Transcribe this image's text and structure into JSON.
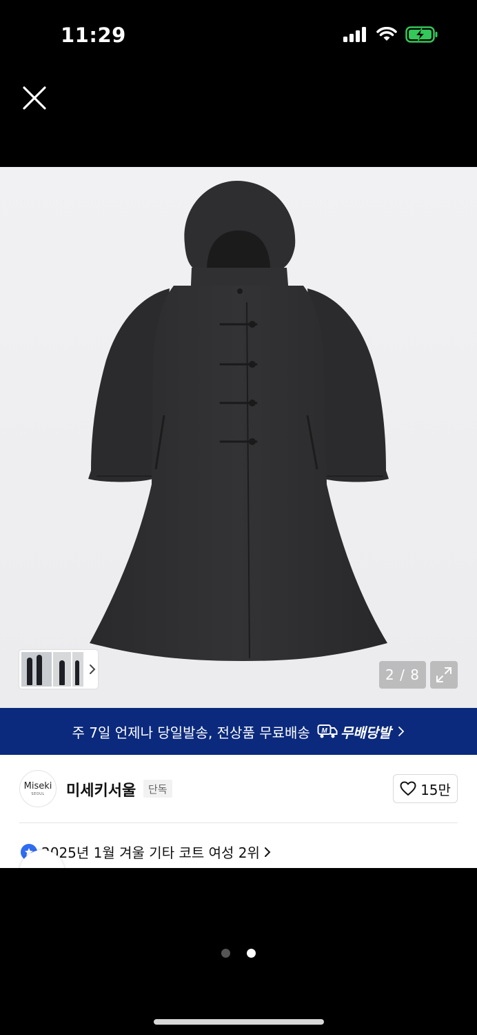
{
  "status_bar": {
    "time": "11:29",
    "icons": [
      "signal-icon",
      "wifi-icon",
      "battery-charging-icon"
    ]
  },
  "viewer": {
    "close_icon": "close-icon",
    "page_counter": "2 / 8",
    "expand_icon": "expand-icon"
  },
  "promo": {
    "text": "주 7일 언제나 당일발송, 전상품 무료배송",
    "badge_label": "무배당발",
    "badge_icon_letter": "M"
  },
  "brand": {
    "logo_text": "Miseki",
    "logo_subtext": "SEOUL",
    "name": "미세키서울",
    "badge": "단독",
    "like_count": "15만"
  },
  "ranking": {
    "text": "2025년 1월 겨울 기타 코트 여성 2위"
  },
  "pagination": {
    "total_dots": 2,
    "active_index": 1
  },
  "colors": {
    "promo_bg": "#0b2a7d",
    "rank_icon": "#2f6cf0",
    "battery": "#34c759"
  }
}
